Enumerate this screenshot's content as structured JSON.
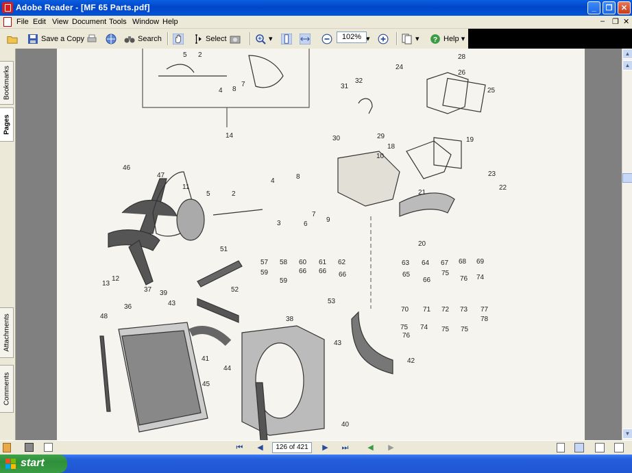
{
  "window": {
    "title": "Adobe Reader - [MF 65 Parts.pdf]"
  },
  "menu": [
    "File",
    "Edit",
    "View",
    "Document",
    "Tools",
    "Window",
    "Help"
  ],
  "toolbar": {
    "save_copy": "Save a Copy",
    "search": "Search",
    "select": "Select",
    "zoom": "102%",
    "help": "Help"
  },
  "side_tabs": {
    "bookmarks": "Bookmarks",
    "pages": "Pages",
    "attachments": "Attachments",
    "comments": "Comments"
  },
  "status": {
    "page": "126 of 421"
  },
  "taskbar": {
    "start": "start"
  },
  "diagram_labels": [
    "5",
    "2",
    "4",
    "8",
    "7",
    "14",
    "28",
    "26",
    "24",
    "25",
    "31",
    "32",
    "30",
    "29",
    "18",
    "10",
    "19",
    "23",
    "22",
    "21",
    "20",
    "46",
    "47",
    "11",
    "5",
    "2",
    "4",
    "8",
    "3",
    "6",
    "7",
    "9",
    "13",
    "12",
    "51",
    "52",
    "37",
    "39",
    "43",
    "36",
    "48",
    "41",
    "44",
    "45",
    "38",
    "43",
    "42",
    "40",
    "57",
    "58",
    "60",
    "61",
    "62",
    "59",
    "59",
    "66",
    "66",
    "66",
    "63",
    "64",
    "67",
    "68",
    "69",
    "65",
    "66",
    "75",
    "76",
    "74",
    "70",
    "71",
    "72",
    "73",
    "77",
    "75",
    "74",
    "75",
    "75",
    "78",
    "76",
    "53"
  ],
  "colors": {
    "titlebar": "#0a5fe0",
    "chrome": "#ece9d8",
    "start": "#3a9c45",
    "page": "#f6f4ef"
  }
}
